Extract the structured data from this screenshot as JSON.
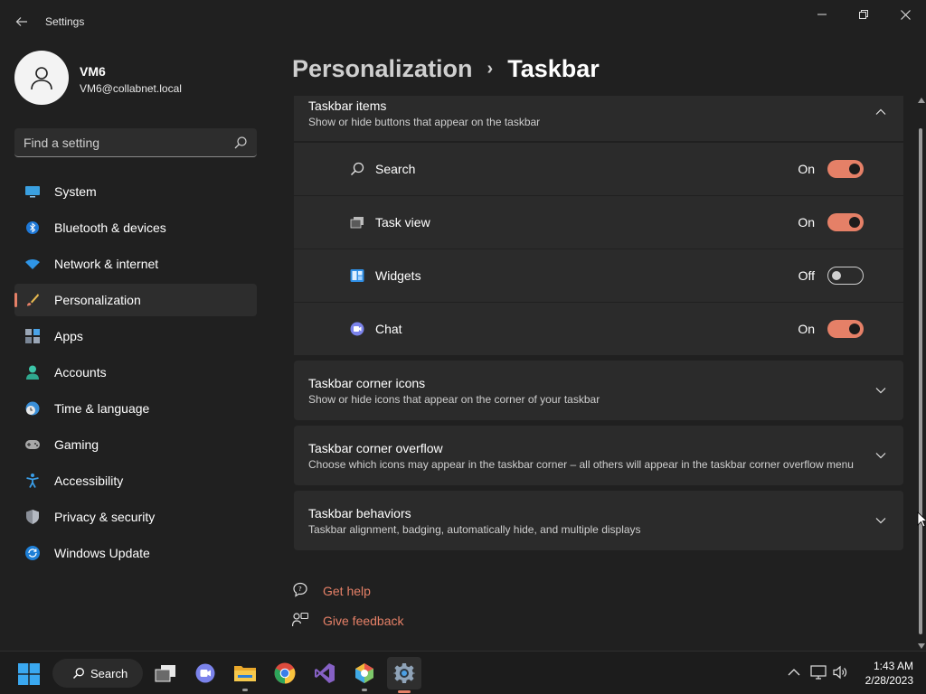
{
  "window": {
    "title": "Settings",
    "back_icon": "arrow-left-icon",
    "controls": [
      "minimize-icon",
      "restore-icon",
      "close-icon"
    ]
  },
  "profile": {
    "name": "VM6",
    "email": "VM6@collabnet.local"
  },
  "search": {
    "placeholder": "Find a setting",
    "value": "",
    "icon": "search-icon"
  },
  "sidebar": {
    "items": [
      {
        "label": "System",
        "icon": "display-icon",
        "active": false
      },
      {
        "label": "Bluetooth & devices",
        "icon": "bluetooth-icon",
        "active": false
      },
      {
        "label": "Network & internet",
        "icon": "wifi-icon",
        "active": false
      },
      {
        "label": "Personalization",
        "icon": "paintbrush-icon",
        "active": true
      },
      {
        "label": "Apps",
        "icon": "apps-icon",
        "active": false
      },
      {
        "label": "Accounts",
        "icon": "person-icon",
        "active": false
      },
      {
        "label": "Time & language",
        "icon": "globe-clock-icon",
        "active": false
      },
      {
        "label": "Gaming",
        "icon": "gamepad-icon",
        "active": false
      },
      {
        "label": "Accessibility",
        "icon": "accessibility-icon",
        "active": false
      },
      {
        "label": "Privacy & security",
        "icon": "shield-icon",
        "active": false
      },
      {
        "label": "Windows Update",
        "icon": "update-icon",
        "active": false
      }
    ]
  },
  "breadcrumb": {
    "parent": "Personalization",
    "separator": "›",
    "current": "Taskbar"
  },
  "sections": {
    "taskbar_items": {
      "title": "Taskbar items",
      "description": "Show or hide buttons that appear on the taskbar",
      "expanded": true,
      "rows": [
        {
          "label": "Search",
          "state": "On",
          "on": true,
          "icon": "search-icon"
        },
        {
          "label": "Task view",
          "state": "On",
          "on": true,
          "icon": "task-view-icon"
        },
        {
          "label": "Widgets",
          "state": "Off",
          "on": false,
          "icon": "widgets-icon"
        },
        {
          "label": "Chat",
          "state": "On",
          "on": true,
          "icon": "chat-icon"
        }
      ]
    },
    "corner_icons": {
      "title": "Taskbar corner icons",
      "description": "Show or hide icons that appear on the corner of your taskbar"
    },
    "corner_overflow": {
      "title": "Taskbar corner overflow",
      "description": "Choose which icons may appear in the taskbar corner – all others will appear in the taskbar corner overflow menu"
    },
    "behaviors": {
      "title": "Taskbar behaviors",
      "description": "Taskbar alignment, badging, automatically hide, and multiple displays"
    }
  },
  "links": {
    "help": "Get help",
    "feedback": "Give feedback"
  },
  "taskbar": {
    "search_label": "Search",
    "apps": [
      "task-view-icon",
      "teams-chat-icon",
      "file-explorer-icon",
      "chrome-icon",
      "visual-studio-icon",
      "paint-app-icon",
      "settings-gear-icon"
    ],
    "active_app": "settings-gear-icon"
  },
  "tray": {
    "time": "1:43 AM",
    "date": "2/28/2023",
    "icons": [
      "chevron-up-icon",
      "network-icon",
      "volume-icon"
    ]
  },
  "colors": {
    "accent": "#e58067",
    "background": "#202020",
    "card": "#2b2b2b",
    "taskbar": "#1c1c1c"
  }
}
